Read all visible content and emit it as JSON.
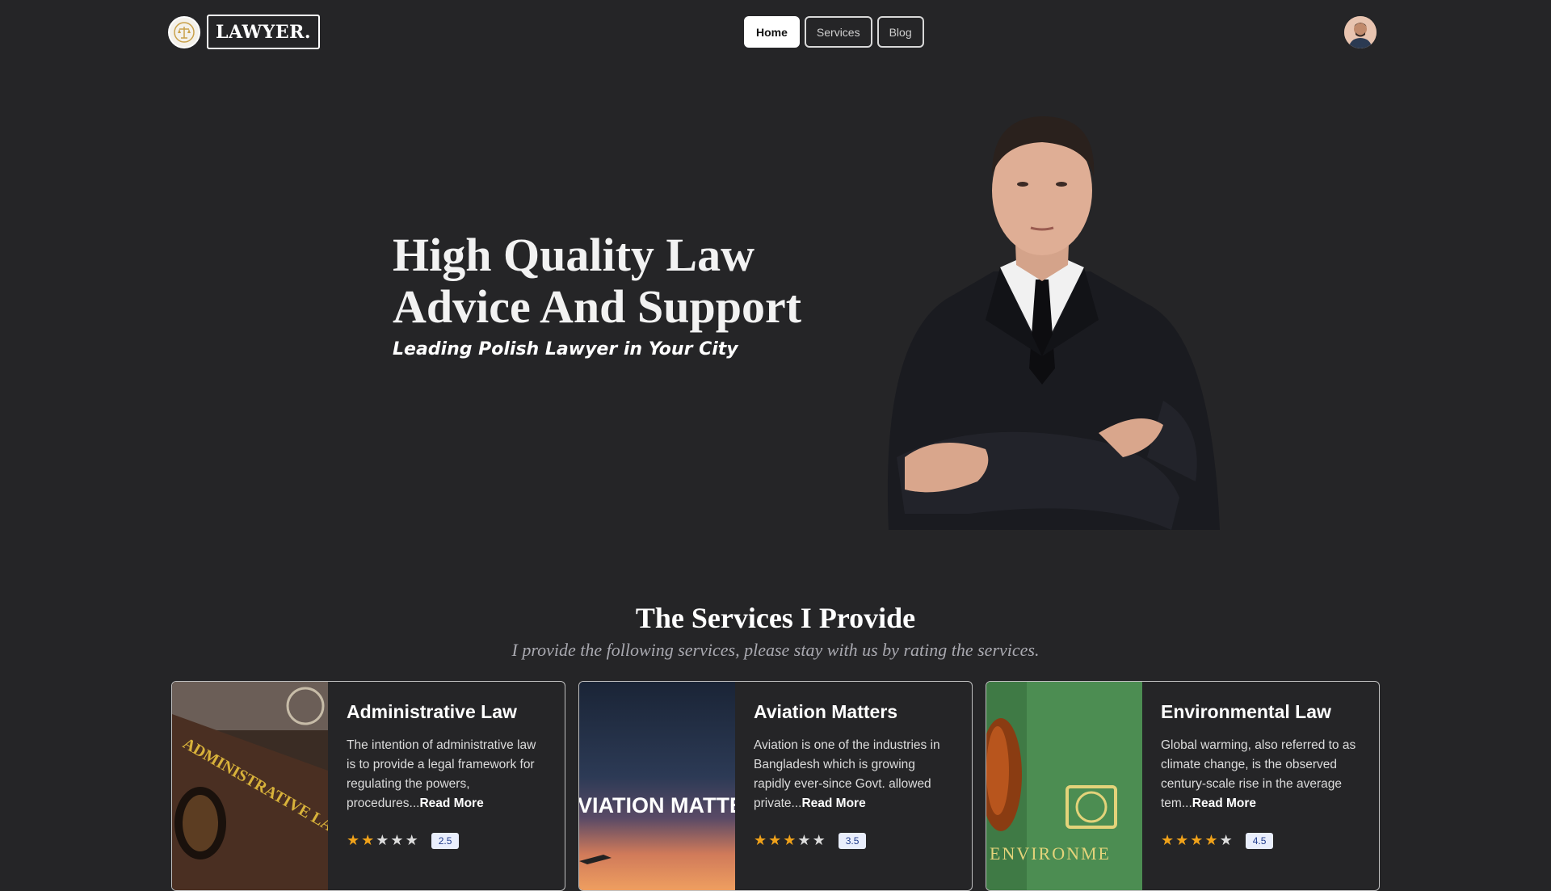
{
  "brand": {
    "name": "LAWYER."
  },
  "nav": {
    "items": [
      {
        "label": "Home",
        "active": true
      },
      {
        "label": "Services",
        "active": false
      },
      {
        "label": "Blog",
        "active": false
      }
    ]
  },
  "hero": {
    "title_line1": "High Quality Law",
    "title_line2": "Advice And Support",
    "subtitle": "Leading Polish Lawyer in Your City"
  },
  "services": {
    "title": "The Services I Provide",
    "subtitle": "I provide the following services, please stay with us by rating the services.",
    "cards": [
      {
        "title": "Administrative Law",
        "text": "The intention of administrative law is to provide a legal framework for regulating the powers, procedures...",
        "read_more": "Read More",
        "stars_filled": 2,
        "rating": "2.5",
        "image_text": "ADMINISTRATIVE LAW"
      },
      {
        "title": "Aviation Matters",
        "text": "Aviation is one of the industries in Bangladesh which is growing rapidly ever-since Govt. allowed private...",
        "read_more": "Read More",
        "stars_filled": 3,
        "rating": "3.5",
        "image_text": "VIATION MATTEI"
      },
      {
        "title": "Environmental Law",
        "text": "Global warming, also referred to as climate change, is the observed century-scale rise in the average tem...",
        "read_more": "Read More",
        "stars_filled": 4,
        "rating": "4.5",
        "image_text": "ENVIRONME"
      }
    ]
  },
  "colors": {
    "background": "#252527",
    "star": "#f0a21a",
    "badge_bg": "#e9eefc",
    "badge_text": "#1f3a8a"
  }
}
